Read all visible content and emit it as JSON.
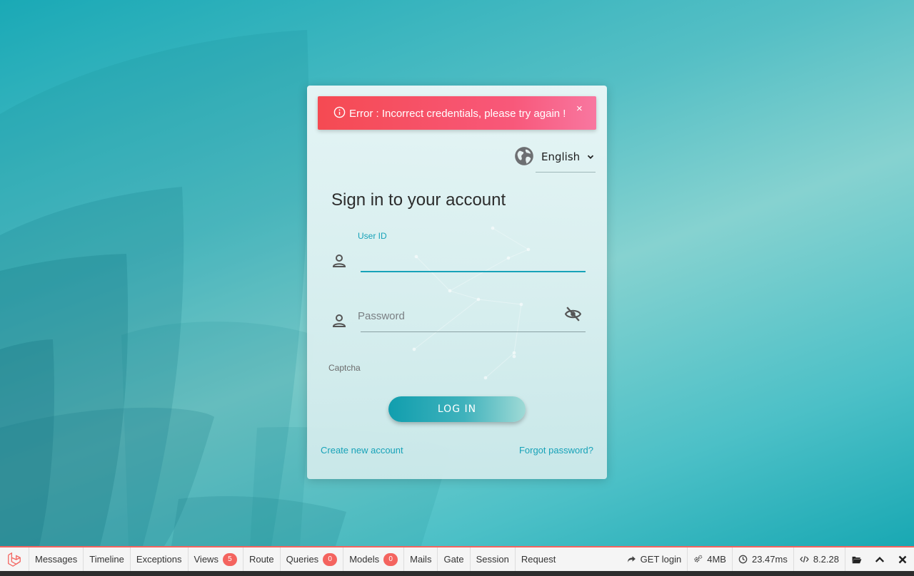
{
  "alert": {
    "message": "Error : Incorrect credentials, please try again !",
    "close_symbol": "×",
    "icon": "info-circle-icon",
    "color": "#f54a52"
  },
  "language": {
    "selected": "English",
    "icon": "globe-icon"
  },
  "login": {
    "title": "Sign in to your account",
    "userid_label": "User ID",
    "userid_value": "",
    "password_placeholder": "Password",
    "password_value": "",
    "captcha_label": "Captcha",
    "submit_label": "LOG IN",
    "create_account_link": "Create new account",
    "forgot_password_link": "Forgot password?",
    "accent_color": "#17a2b8"
  },
  "debugbar": {
    "accent_color": "#f4645f",
    "tabs": [
      {
        "label": "Messages"
      },
      {
        "label": "Timeline"
      },
      {
        "label": "Exceptions"
      },
      {
        "label": "Views",
        "badge": "5"
      },
      {
        "label": "Route"
      },
      {
        "label": "Queries",
        "badge": "0"
      },
      {
        "label": "Models",
        "badge": "0"
      },
      {
        "label": "Mails"
      },
      {
        "label": "Gate"
      },
      {
        "label": "Session"
      },
      {
        "label": "Request"
      }
    ],
    "route": "GET login",
    "memory": "4MB",
    "time": "23.47ms",
    "php_version": "8.2.28"
  }
}
